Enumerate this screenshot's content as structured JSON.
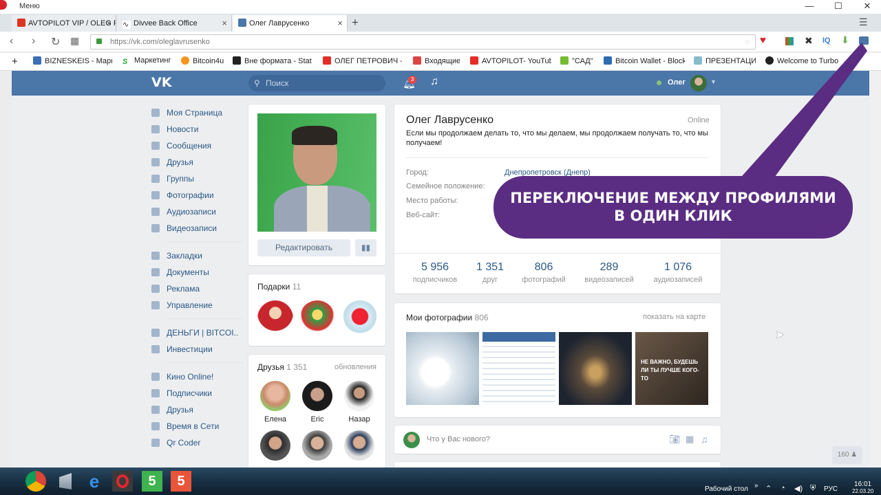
{
  "browser": {
    "menu": "Меню",
    "url": "https://vk.com/oleglavrusenko",
    "tabs": [
      {
        "label": "AVTOPILOT VIP / OLEG PE"
      },
      {
        "label": "Divvee Back Office"
      },
      {
        "label": "Олег Лаврусенко"
      }
    ],
    "bookmarks": [
      "BIZNESKEIS - Маркет",
      "Маркетинг",
      "Bitcoin4u",
      "Вне формата - Statis",
      "ОЛЕГ ПЕТРОВИЧ - Y",
      "Входящие",
      "AVTOPILOT- YouTube",
      "\"САД\"",
      "Bitcoin Wallet - Block",
      "ПРЕЗЕНТАЦИЯ",
      "Welcome to Turbo"
    ],
    "ext": {
      "iq": "IQ"
    }
  },
  "vk": {
    "logo": "VK",
    "search_placeholder": "Поиск",
    "notif_count": "3",
    "user_name": "Олег",
    "menu": [
      "Моя Страница",
      "Новости",
      "Сообщения",
      "Друзья",
      "Группы",
      "Фотографии",
      "Аудиозаписи",
      "Видеозаписи"
    ],
    "menu2": [
      "Закладки",
      "Документы",
      "Реклама",
      "Управление"
    ],
    "menu3": [
      "ДЕНЬГИ | BITCOI..",
      "Инвестиции"
    ],
    "menu4": [
      "Кино Online!",
      "Подписчики",
      "Друзья",
      "Время в Сети",
      "Qr Coder"
    ],
    "edit_button": "Редактировать",
    "gifts": {
      "title": "Подарки",
      "count": "11"
    },
    "friends": {
      "title": "Друзья",
      "count": "1 351",
      "updates": "обновления",
      "names": [
        "Елена",
        "Eric",
        "Назар",
        "",
        "",
        " "
      ]
    },
    "profile": {
      "name": "Олег Лаврусенко",
      "online": "Online",
      "status": "Если мы продолжаем делать то, что мы делаем, мы продолжаем получать то, что мы получаем!",
      "labels": [
        "Город:",
        "Семейное положение:",
        "Место работы:",
        "Веб-сайт:"
      ],
      "city": "Днепропетровск (Днепр)"
    },
    "stats": [
      {
        "n": "5 956",
        "l": "подписчиков"
      },
      {
        "n": "1 351",
        "l": "друг"
      },
      {
        "n": "806",
        "l": "фотографий"
      },
      {
        "n": "289",
        "l": "видеозаписей"
      },
      {
        "n": "1 076",
        "l": "аудиозаписей"
      }
    ],
    "photos": {
      "title": "Мои фотографии",
      "count": "806",
      "map": "показать на карте",
      "photo4_text": "НЕ ВАЖНО, БУДЕШЬ ЛИ ТЫ ЛУЧШЕ КОГО-ТО"
    },
    "post_placeholder": "Что у Вас нового?",
    "online_counter": "160"
  },
  "overlay": {
    "line1": "ПЕРЕКЛЮЧЕНИЕ МЕЖДУ ПРОФИЛЯМИ",
    "line2": "В ОДИН КЛИК"
  },
  "taskbar": {
    "desktop": "Рабочий стол",
    "lang": "РУС",
    "time": "16:01",
    "date": "22.03.20"
  },
  "colors": {
    "vk_blue": "#4a76a8",
    "callout": "#5a2d82"
  }
}
